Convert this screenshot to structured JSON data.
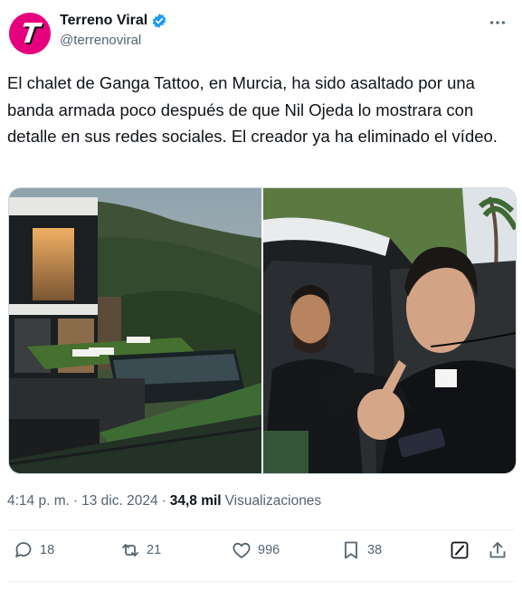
{
  "account": {
    "display_name": "Terreno Viral",
    "handle": "@terrenoviral",
    "avatar_letter": "T",
    "avatar_color": "#e6007e",
    "verified": true
  },
  "tweet": {
    "text": "El chalet de Ganga Tattoo, en Murcia, ha sido asaltado por una banda armada poco después de que Nil Ojeda lo mostrara con detalle en sus redes sociales. El creador ya ha eliminado el vídeo.",
    "time": "4:14 p. m.",
    "separator": "·",
    "date": "13 dic. 2024",
    "views_count": "34,8 mil",
    "views_label": "Visualizaciones"
  },
  "actions": {
    "replies": "18",
    "reposts": "21",
    "likes": "996",
    "bookmarks": "38"
  },
  "icons": [
    "verified-badge-icon",
    "more-icon",
    "reply-icon",
    "repost-icon",
    "like-icon",
    "bookmark-icon",
    "grok-icon",
    "share-icon"
  ],
  "colors": {
    "accent": "#1d9bf0",
    "text": "#0f1419",
    "secondary": "#536471"
  }
}
